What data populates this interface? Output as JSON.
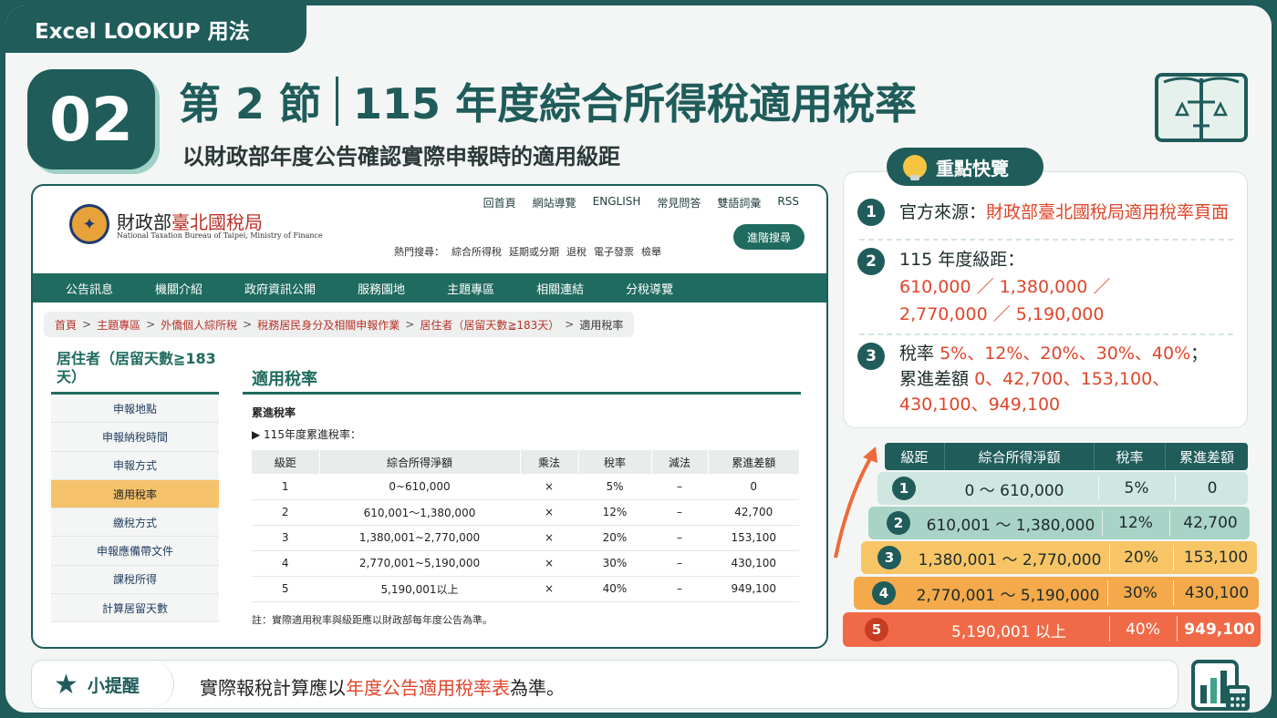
{
  "top_tag": "Excel LOOKUP 用法",
  "section_number": "02",
  "heading_left": "第 2 節",
  "heading_right": "115 年度綜合所得稅適用稅率",
  "subtitle": "以財政部年度公告確認實際申報時的適用級距",
  "site": {
    "logo_cn_a": "財政部",
    "logo_cn_b": "臺北國稅局",
    "logo_en": "National Taxation Bureau of Taipei, Ministry of Finance",
    "toplinks": [
      "回首頁",
      "網站導覽",
      "ENGLISH",
      "常見問答",
      "雙語詞彙",
      "RSS"
    ],
    "hot_label": "熱門搜尋：",
    "hot_items": [
      "綜合所得稅",
      "延期或分期",
      "退稅",
      "電子發票",
      "檢舉"
    ],
    "adv_search": "進階搜尋",
    "nav": [
      "公告訊息",
      "機關介紹",
      "政府資訊公開",
      "服務園地",
      "主題專區",
      "相關連結",
      "分稅導覽"
    ],
    "breadcrumb": [
      "首頁",
      "主題專區",
      "外僑個人綜所稅",
      "稅務居民身分及相關申報作業",
      "居住者（居留天數≧183天）",
      "適用稅率"
    ],
    "side_title": "居住者（居留天數≧183天）",
    "side_items": [
      "申報地點",
      "申報納稅時間",
      "申報方式",
      "適用稅率",
      "繳稅方式",
      "申報應備帶文件",
      "課稅所得",
      "計算居留天數"
    ],
    "main_title": "適用稅率",
    "prog_label": "累進稅率",
    "prog_sub": "▶ 115年度累進稅率：",
    "table_head": [
      "級距",
      "綜合所得淨額",
      "乘法",
      "稅率",
      "減法",
      "累進差額"
    ],
    "table_rows": [
      [
        "1",
        "0~610,000",
        "×",
        "5%",
        "–",
        "0"
      ],
      [
        "2",
        "610,001～1,380,000",
        "×",
        "12%",
        "–",
        "42,700"
      ],
      [
        "3",
        "1,380,001~2,770,000",
        "×",
        "20%",
        "–",
        "153,100"
      ],
      [
        "4",
        "2,770,001~5,190,000",
        "×",
        "30%",
        "–",
        "430,100"
      ],
      [
        "5",
        "5,190,001以上",
        "×",
        "40%",
        "–",
        "949,100"
      ]
    ],
    "note": "註：實際適用稅率與級距應以財政部每年度公告為準。"
  },
  "highlights": {
    "title": "重點快覽",
    "item1_label": "官方來源：",
    "item1_value": "財政部臺北國稅局適用稅率頁面",
    "item2_label": "115 年度級距：",
    "item2_line1": "610,000 ／ 1,380,000 ／",
    "item2_line2": "2,770,000 ／ 5,190,000",
    "item3_label": "稅率",
    "item3_rates": "5%、12%、20%、30%、40%",
    "item3_semicolon": "；",
    "item3_label2": "累進差額",
    "item3_diff1": "0、42,700、153,100、",
    "item3_diff2": "430,100、949,100"
  },
  "brackets": {
    "head": [
      "級距",
      "綜合所得淨額",
      "稅率",
      "累進差額"
    ],
    "rows": [
      {
        "n": "1",
        "range": "0 ～ 610,000",
        "rate": "5%",
        "diff": "0",
        "color": "#cfe7e1"
      },
      {
        "n": "2",
        "range": "610,001 ～ 1,380,000",
        "rate": "12%",
        "diff": "42,700",
        "color": "#a9d3c6"
      },
      {
        "n": "3",
        "range": "1,380,001 ～ 2,770,000",
        "rate": "20%",
        "diff": "153,100",
        "color": "#f7c566"
      },
      {
        "n": "4",
        "range": "2,770,001 ～ 5,190,000",
        "rate": "30%",
        "diff": "430,100",
        "color": "#f4a94a"
      },
      {
        "n": "5",
        "range": "5,190,001 以上",
        "rate": "40%",
        "diff": "949,100",
        "color": "#f06a48"
      }
    ]
  },
  "tip": {
    "label": "小提醒",
    "text_a": "實際報稅計算應以",
    "text_b": "年度公告適用稅率表",
    "text_c": "為準。"
  }
}
